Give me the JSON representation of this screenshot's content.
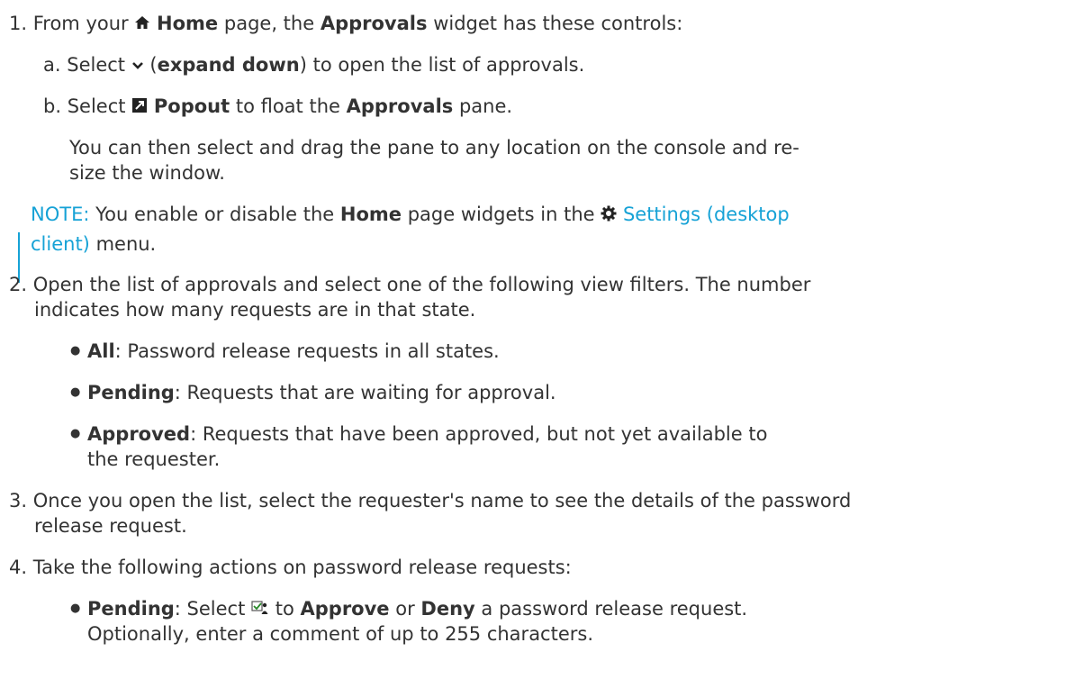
{
  "steps": {
    "s1": {
      "num": "1.",
      "t1": "From your",
      "home_icon": "home-icon",
      "home": "Home",
      "t2": "page, the",
      "approvals": "Approvals",
      "t3": "widget has these controls:"
    },
    "s1a": {
      "letter": "a.",
      "t1": "Select",
      "chevron_icon": "chevron-down-icon",
      "t2": "(",
      "expand": "expand down",
      "t3": ") to open the list of approvals."
    },
    "s1b": {
      "letter": "b.",
      "t1": "Select",
      "popout_icon": "popout-icon",
      "popout": "Popout",
      "t2": "to float the",
      "approvals": "Approvals",
      "t3": "pane.",
      "p1": "You can then select and drag the pane to any location on the console and re-",
      "p2": "size the window."
    },
    "note": {
      "label": "NOTE:",
      "t1": "You enable or disable the",
      "home": "Home",
      "t2": "page widgets in the",
      "gear_icon": "gear-icon",
      "link1": "Settings (desktop",
      "link2": "client)",
      "t3": "menu."
    },
    "s2": {
      "num": "2.",
      "l1": "Open the list of approvals and select one of the following view filters. The number",
      "l2": "indicates how many requests are in that state.",
      "bullets": [
        {
          "term": "All",
          "text": ": Password release requests in all states."
        },
        {
          "term": "Pending",
          "text": ": Requests that are waiting for approval."
        },
        {
          "term": "Approved",
          "text": ": Requests that have been approved, but not yet available to",
          "cont": "the  requester."
        }
      ]
    },
    "s3": {
      "num": "3.",
      "l1": "Once you open the list, select the requester's name to see the details of the password",
      "l2": "release request."
    },
    "s4": {
      "num": "4.",
      "l1": "Take the following actions on password release requests:",
      "b1_term": "Pending",
      "b1_t1": ": Select",
      "approve_icon": "approve-deny-icon",
      "b1_t2": "to",
      "approve": "Approve",
      "b1_t3": "or",
      "deny": "Deny",
      "b1_t4": "a password release request.",
      "b1_l2": "Optionally, enter a comment of up to 255 characters."
    }
  }
}
